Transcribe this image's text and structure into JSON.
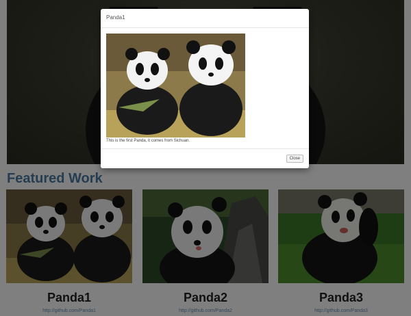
{
  "section": {
    "title": "Featured Work"
  },
  "cards": [
    {
      "name": "Panda1",
      "link": "http://github.com/Panda1",
      "image": "two-pandas-eating-bamboo"
    },
    {
      "name": "Panda2",
      "link": "http://github.com/Panda2",
      "image": "panda-by-tree"
    },
    {
      "name": "Panda3",
      "link": "http://github.com/Panda3",
      "image": "panda-on-grass"
    }
  ],
  "modal": {
    "title": "Panda1",
    "caption": "This is the first Panda, it comes from Sichuan.",
    "close_label": "Close",
    "image": "two-pandas-eating-bamboo"
  },
  "colors": {
    "accent": "#4b7aa3",
    "backdrop": "rgba(0,0,0,0.5)",
    "link": "#6b8fb3"
  }
}
